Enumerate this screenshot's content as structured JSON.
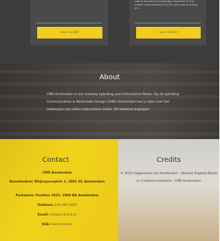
{
  "top_cards": {
    "left_button_label": "Lees verder",
    "right_text": "web is becoming increasingly important to the\nmobile world because it is the only way to deploy\non...",
    "right_button_label": "Lees verder"
  },
  "about": {
    "title": "About",
    "text": "CMD Amsterdam is een ontwerp opleiding voor Interactieve Media. Op de opleiding Communication & Multimedia Design (CMD) Amsterdam leer je alles over het ontwerpen van online interactieve media. Dit betekent begrijpen,"
  },
  "contact": {
    "title": "Contact",
    "org": "CMD Amsterdam",
    "visit_label": "Bezoekadres: Rhijnspoorplein 1, 1091 GC Amsterdam",
    "postal_label": "Postadres: Postbus 1025, 1000 BA Amsterdam",
    "phone_label": "Telefoon:",
    "phone_value": "020 595 1855",
    "email_label": "Email:",
    "email_value": "info@cmd.hva.nl",
    "rss_label": "RSS:",
    "rss_value": "Feed intranet"
  },
  "credits": {
    "title": "Credits",
    "text": "© 2015 Hogeschool van Amsterdam - Domein Digitale Media en Creatieve Industrie - CMD Amsterdam"
  },
  "colors": {
    "accent_yellow": "#f2cc1f",
    "dark_bg": "#3c3c3c",
    "contact_bg": "#f0d21b",
    "credits_bg": "#d9d9d5"
  }
}
